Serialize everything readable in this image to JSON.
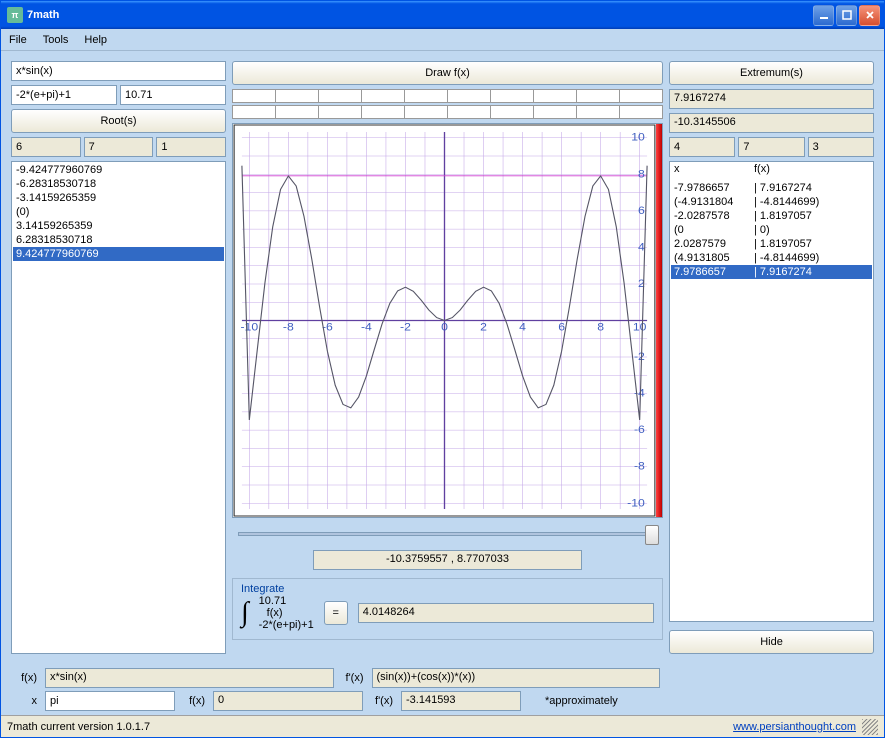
{
  "title": "7math",
  "menu": {
    "file": "File",
    "tools": "Tools",
    "help": "Help"
  },
  "left": {
    "func_input": "x*sin(x)",
    "lower": "-2*(e+pi)+1",
    "upper": "10.71",
    "roots_btn": "Root(s)",
    "roots_params": [
      "6",
      "7",
      "1"
    ],
    "roots": [
      "-9.424777960769",
      "-6.28318530718",
      "-3.14159265359",
      "(0)",
      "3.14159265359",
      "6.28318530718",
      "9.424777960769"
    ],
    "roots_selected_index": 6
  },
  "center": {
    "draw_btn": "Draw f(x)",
    "range_display": "-10.3759557 , 8.7707033",
    "integrate_label": "Integrate",
    "int_upper": "10.71",
    "int_mid": "f(x)",
    "int_lower": "-2*(e+pi)+1",
    "eq": "=",
    "int_result": "4.0148264"
  },
  "right": {
    "extremum_btn": "Extremum(s)",
    "ext_top1": "7.9167274",
    "ext_top2": "-10.3145506",
    "ext_params": [
      "4",
      "7",
      "3"
    ],
    "ext_header_x": "x",
    "ext_header_fx": "f(x)",
    "ext_rows": [
      {
        "x": "-7.9786657",
        "fx": "7.9167274"
      },
      {
        "x": "(-4.9131804",
        "fx": "-4.8144699)"
      },
      {
        "x": "-2.0287578",
        "fx": "1.8197057"
      },
      {
        "x": "(0",
        "fx": "0)"
      },
      {
        "x": "2.0287579",
        "fx": "1.8197057"
      },
      {
        "x": "(4.9131805",
        "fx": "-4.8144699)"
      },
      {
        "x": "7.9786657",
        "fx": "7.9167274"
      }
    ],
    "ext_selected_index": 6,
    "hide_btn": "Hide"
  },
  "bottom": {
    "fx_lab": "f(x)",
    "fx_val": "x*sin(x)",
    "fpx_lab": "f'(x)",
    "fpx_val": "(sin(x))+(cos(x))*(x))",
    "x_lab": "x",
    "x_val": "pi",
    "fx2_lab": "f(x)",
    "fx2_val": "0",
    "fpx2_lab": "f'(x)",
    "fpx2_val": "-3.141593",
    "approx": "*approximately"
  },
  "status": {
    "left": "7math current version 1.0.1.7",
    "link": "www.persianthought.com"
  },
  "chart_data": {
    "type": "line",
    "title": "",
    "xlabel": "",
    "ylabel": "",
    "xlim": [
      -10.38,
      10.38
    ],
    "ylim": [
      -10.31,
      10.31
    ],
    "xticks": [
      -10,
      -8,
      -6,
      -4,
      -2,
      0,
      2,
      4,
      6,
      8,
      10
    ],
    "yticks": [
      -10,
      -8,
      -6,
      -4,
      -2,
      0,
      2,
      4,
      6,
      8,
      10
    ],
    "hline": 7.9167274,
    "series": [
      {
        "name": "x*sin(x)",
        "x": [
          -10.38,
          -10,
          -9.6,
          -9.2,
          -8.8,
          -8.4,
          -8,
          -7.6,
          -7.2,
          -6.8,
          -6.4,
          -6,
          -5.6,
          -5.2,
          -4.8,
          -4.4,
          -4,
          -3.6,
          -3.2,
          -2.8,
          -2.4,
          -2,
          -1.6,
          -1.2,
          -0.8,
          -0.4,
          0,
          0.4,
          0.8,
          1.2,
          1.6,
          2,
          2.4,
          2.8,
          3.2,
          3.6,
          4,
          4.4,
          4.8,
          5.2,
          5.6,
          6,
          6.4,
          6.8,
          7.2,
          7.6,
          8,
          8.4,
          8.8,
          9.2,
          9.6,
          10,
          10.38
        ],
        "y": [
          8.47,
          -5.44,
          -1.67,
          2.06,
          5.13,
          7.17,
          7.91,
          7.36,
          5.7,
          3.36,
          0.75,
          -1.68,
          -3.54,
          -4.59,
          -4.78,
          -4.19,
          -3.03,
          -1.59,
          -0.19,
          0.94,
          1.62,
          1.82,
          1.6,
          1.12,
          0.57,
          0.16,
          0,
          0.16,
          0.57,
          1.12,
          1.6,
          1.82,
          1.62,
          0.94,
          -0.19,
          -1.59,
          -3.03,
          -4.19,
          -4.78,
          -4.59,
          -3.54,
          -1.68,
          0.75,
          3.36,
          5.7,
          7.36,
          7.91,
          7.17,
          5.13,
          2.06,
          -1.67,
          -5.44,
          8.47
        ]
      }
    ]
  }
}
